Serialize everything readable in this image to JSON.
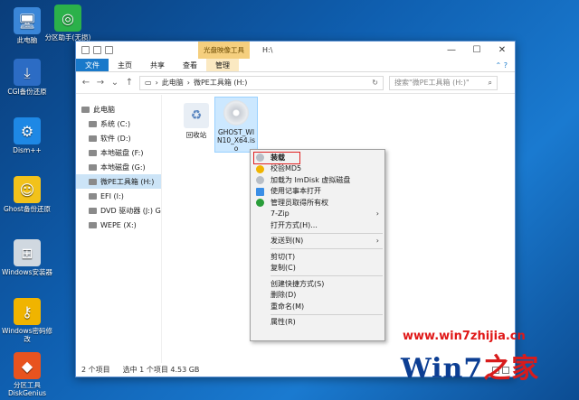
{
  "desktop": {
    "icons": [
      {
        "label": "此电脑",
        "icon": "computer-icon",
        "color": "#3a86d8"
      },
      {
        "label": "分区助手(无损)",
        "icon": "partition-assistant-icon",
        "color": "#2bb14a"
      },
      {
        "label": "CGI备份还原",
        "icon": "cgi-backup-icon",
        "color": "#2c6cc4"
      },
      {
        "label": "Dism++",
        "icon": "dism-gear-icon",
        "color": "#1e88e5"
      },
      {
        "label": "Ghost备份还原",
        "icon": "ghost-icon",
        "color": "#f2c21b"
      },
      {
        "label": "Windows安装器",
        "icon": "windows-installer-icon",
        "color": "#d0d8e0"
      },
      {
        "label": "Windows密码修改",
        "icon": "key-icon",
        "color": "#f0b400"
      },
      {
        "label": "分区工具DiskGenius",
        "icon": "diskgenius-icon",
        "color": "#e8531f"
      }
    ]
  },
  "window": {
    "context_tab_head": "光盘映像工具",
    "title": "H:\\",
    "buttons": {
      "minimize": "—",
      "maximize": "☐",
      "close": "✕"
    },
    "ribbon_tabs": [
      "文件",
      "主页",
      "共享",
      "查看",
      "管理"
    ],
    "help": "⌃ ?",
    "address": {
      "path": [
        "此电脑",
        "微PE工具箱 (H:)"
      ],
      "chevron": "›"
    },
    "search_placeholder": "搜索\"微PE工具箱 (H:)\"",
    "nav": [
      {
        "label": "此电脑",
        "level": 0
      },
      {
        "label": "系统 (C:)",
        "level": 1
      },
      {
        "label": "软件 (D:)",
        "level": 1
      },
      {
        "label": "本地磁盘 (F:)",
        "level": 1
      },
      {
        "label": "本地磁盘 (G:)",
        "level": 1
      },
      {
        "label": "微PE工具箱 (H:)",
        "level": 1,
        "selected": true
      },
      {
        "label": "EFI (I:)",
        "level": 1
      },
      {
        "label": "DVD 驱动器 (J:) GH",
        "level": 1
      },
      {
        "label": "WEPE (X:)",
        "level": 1
      }
    ],
    "files": [
      {
        "name": "回收站",
        "icon": "recycle-bin-icon"
      },
      {
        "name": "GHOST_WIN10_X64.iso",
        "icon": "iso-disc-icon",
        "selected": true
      }
    ],
    "status": {
      "count": "2 个项目",
      "selected": "选中 1 个项目  4.53 GB"
    }
  },
  "context_menu": [
    {
      "label": "装载",
      "icon": "disc-icon",
      "bold": true,
      "highlighted": true
    },
    {
      "label": "校验MD5",
      "icon": "shield-check-icon"
    },
    {
      "label": "加载为 ImDisk 虚拟磁盘",
      "icon": "disc-icon"
    },
    {
      "label": "使用记事本打开",
      "icon": "notepad-icon"
    },
    {
      "label": "管理员取得所有权",
      "icon": "admin-shield-icon"
    },
    {
      "label": "7-Zip",
      "submenu": true
    },
    {
      "label": "打开方式(H)..."
    },
    {
      "sep": true
    },
    {
      "label": "发送到(N)",
      "submenu": true
    },
    {
      "sep": true
    },
    {
      "label": "剪切(T)"
    },
    {
      "label": "复制(C)"
    },
    {
      "sep": true
    },
    {
      "label": "创建快捷方式(S)"
    },
    {
      "label": "删除(D)"
    },
    {
      "label": "重命名(M)"
    },
    {
      "sep": true
    },
    {
      "label": "属性(R)"
    }
  ],
  "watermark": {
    "url": "www.win7zhijia.cn",
    "logo_left": "Win7",
    "logo_right": "之家"
  }
}
